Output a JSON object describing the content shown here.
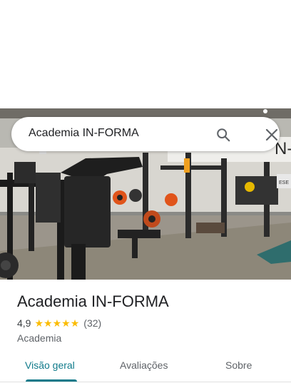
{
  "search": {
    "query": "Academia IN-FORMA"
  },
  "photo": {
    "wall_text": "N-FO",
    "sign_text": "ESE"
  },
  "place": {
    "name": "Academia IN-FORMA",
    "rating": "4,9",
    "stars": 5,
    "review_count": "(32)",
    "category": "Academia"
  },
  "tabs": [
    {
      "label": "Visão geral",
      "active": true
    },
    {
      "label": "Avaliações",
      "active": false
    },
    {
      "label": "Sobre",
      "active": false
    }
  ],
  "colors": {
    "accent": "#0f7a8a",
    "star": "#fbbc04"
  }
}
